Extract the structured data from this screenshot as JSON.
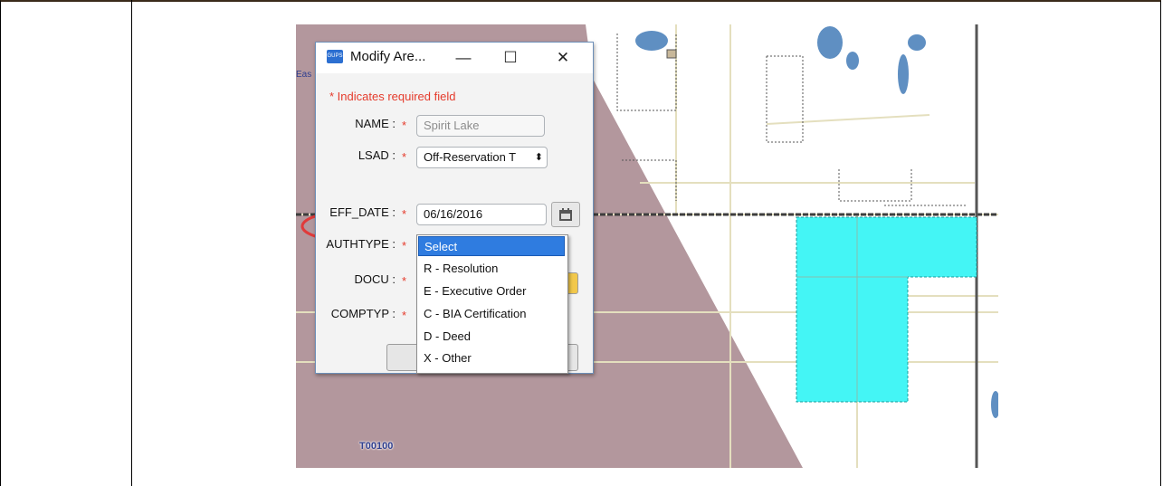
{
  "map": {
    "township_label": "T00100",
    "side_label": "Eas",
    "colors": {
      "reservation": "#b3979d",
      "selected_parcel": "#44f5f5",
      "water": "#5f8fc2",
      "road": "#e4dfbe"
    }
  },
  "dialog": {
    "app_icon": "GUPS",
    "title": "Modify Are...",
    "controls": {
      "minimize": "—",
      "maximize": "☐",
      "close": "✕"
    },
    "required_note": "* Indicates required field",
    "fields": {
      "name": {
        "label": "NAME :",
        "star": "*",
        "value": "Spirit Lake"
      },
      "lsad": {
        "label": "LSAD :",
        "star": "*",
        "value": "Off-Reservation T",
        "arrow": "⬍"
      },
      "eff_date": {
        "label": "EFF_DATE :",
        "star": "*",
        "value": "06/16/2016",
        "icon": "calendar-icon"
      },
      "authtype": {
        "label": "AUTHTYPE :",
        "star": "*"
      },
      "docu": {
        "label": "DOCU :",
        "star": "*"
      },
      "comptyp": {
        "label": "COMPTYP :",
        "star": "*"
      }
    },
    "authtype_dropdown": {
      "options": [
        "Select",
        "R - Resolution",
        "E - Executive Order",
        "C - BIA Certification",
        "D - Deed",
        "X - Other"
      ],
      "selected": "Select"
    }
  },
  "annotations": {
    "color": "#e03a3a",
    "circled": [
      "AUTHTYPE :",
      "D - Deed"
    ]
  }
}
